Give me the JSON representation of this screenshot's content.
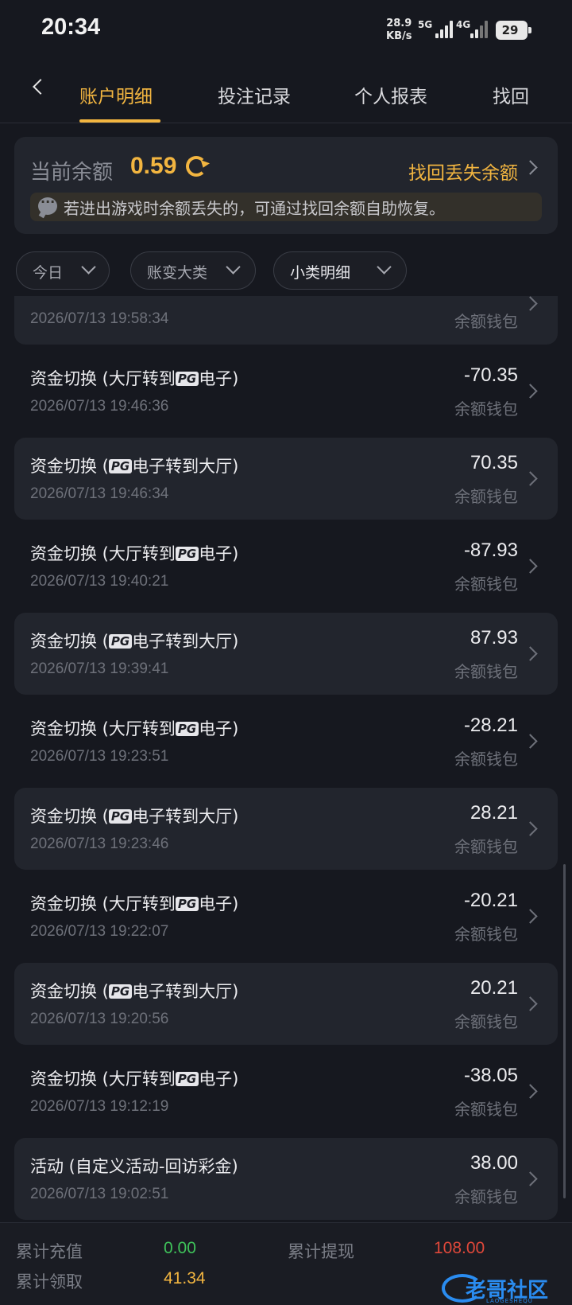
{
  "status_bar": {
    "time": "20:34",
    "net_speed_value": "28.9",
    "net_speed_unit": "KB/s",
    "signal_1": "5G",
    "signal_2": "4G",
    "battery": "29"
  },
  "nav": {
    "tabs": [
      "账户明细",
      "投注记录",
      "个人报表",
      "找回"
    ],
    "active_tab": 0
  },
  "balance": {
    "label": "当前余额",
    "value": "0.59",
    "recover_link": "找回丢失余额",
    "notice": "若进出游戏时余额丢失的，可通过找回余额自助恢复。"
  },
  "filters": [
    {
      "label": "今日"
    },
    {
      "label": "账变大类"
    },
    {
      "label": "小类明细"
    }
  ],
  "transactions": [
    {
      "title_pre": "",
      "badge": "",
      "title_post": "",
      "time": "2026/07/13 19:58:34",
      "amount": "",
      "wallet": "余额钱包"
    },
    {
      "title_pre": "资金切换 (大厅转到",
      "badge": "PG",
      "title_post": "电子)",
      "time": "2026/07/13 19:46:36",
      "amount": "-70.35",
      "wallet": "余额钱包"
    },
    {
      "title_pre": "资金切换 (",
      "badge": "PG",
      "title_post": "电子转到大厅)",
      "time": "2026/07/13 19:46:34",
      "amount": "70.35",
      "wallet": "余额钱包"
    },
    {
      "title_pre": "资金切换 (大厅转到",
      "badge": "PG",
      "title_post": "电子)",
      "time": "2026/07/13 19:40:21",
      "amount": "-87.93",
      "wallet": "余额钱包"
    },
    {
      "title_pre": "资金切换 (",
      "badge": "PG",
      "title_post": "电子转到大厅)",
      "time": "2026/07/13 19:39:41",
      "amount": "87.93",
      "wallet": "余额钱包"
    },
    {
      "title_pre": "资金切换 (大厅转到",
      "badge": "PG",
      "title_post": "电子)",
      "time": "2026/07/13 19:23:51",
      "amount": "-28.21",
      "wallet": "余额钱包"
    },
    {
      "title_pre": "资金切换 (",
      "badge": "PG",
      "title_post": "电子转到大厅)",
      "time": "2026/07/13 19:23:46",
      "amount": "28.21",
      "wallet": "余额钱包"
    },
    {
      "title_pre": "资金切换 (大厅转到",
      "badge": "PG",
      "title_post": "电子)",
      "time": "2026/07/13 19:22:07",
      "amount": "-20.21",
      "wallet": "余额钱包"
    },
    {
      "title_pre": "资金切换 (",
      "badge": "PG",
      "title_post": "电子转到大厅)",
      "time": "2026/07/13 19:20:56",
      "amount": "20.21",
      "wallet": "余额钱包"
    },
    {
      "title_pre": "资金切换 (大厅转到",
      "badge": "PG",
      "title_post": "电子)",
      "time": "2026/07/13 19:12:19",
      "amount": "-38.05",
      "wallet": "余额钱包"
    },
    {
      "title_pre": "活动 (自定义活动-回访彩金)",
      "badge": "",
      "title_post": "",
      "time": "2026/07/13 19:02:51",
      "amount": "38.00",
      "wallet": "余额钱包"
    }
  ],
  "summary": {
    "deposit_label": "累计充值",
    "deposit_value": "0.00",
    "withdraw_label": "累计提现",
    "withdraw_value": "108.00",
    "claim_label": "累计领取",
    "claim_value": "41.34"
  },
  "watermark": {
    "text": "老哥社区",
    "sub": "LAOGESHEQU"
  },
  "colors": {
    "accent": "#f2b540",
    "positive": "#3fc25a",
    "negative": "#e0483a",
    "claim": "#f2b540",
    "watermark": "#2a8cf0"
  }
}
